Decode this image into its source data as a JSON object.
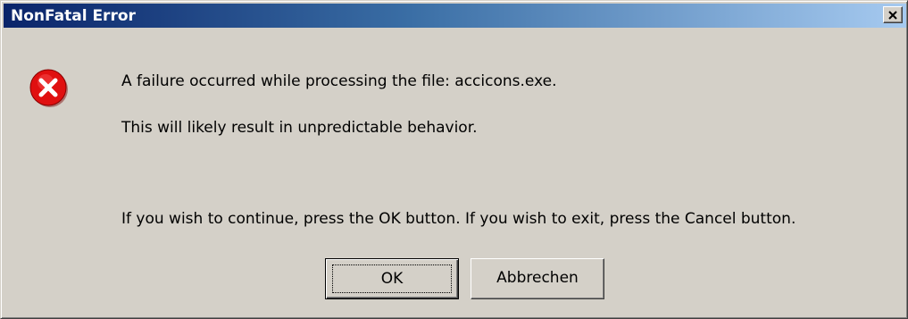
{
  "window": {
    "title": "NonFatal Error",
    "close_icon": "close-icon"
  },
  "message": {
    "icon": "error-icon",
    "line1": "A failure occurred while processing the file: accicons.exe.",
    "line2": "This will likely result in unpredictable behavior.",
    "line3": "If you wish to continue, press the OK button.  If you wish to exit, press the Cancel button."
  },
  "buttons": {
    "ok_label": "OK",
    "cancel_label": "Abbrechen"
  },
  "colors": {
    "titlebar_start": "#0a246a",
    "titlebar_end": "#a6caf0",
    "dialog_bg": "#d4d0c8",
    "error_red": "#e01010"
  }
}
